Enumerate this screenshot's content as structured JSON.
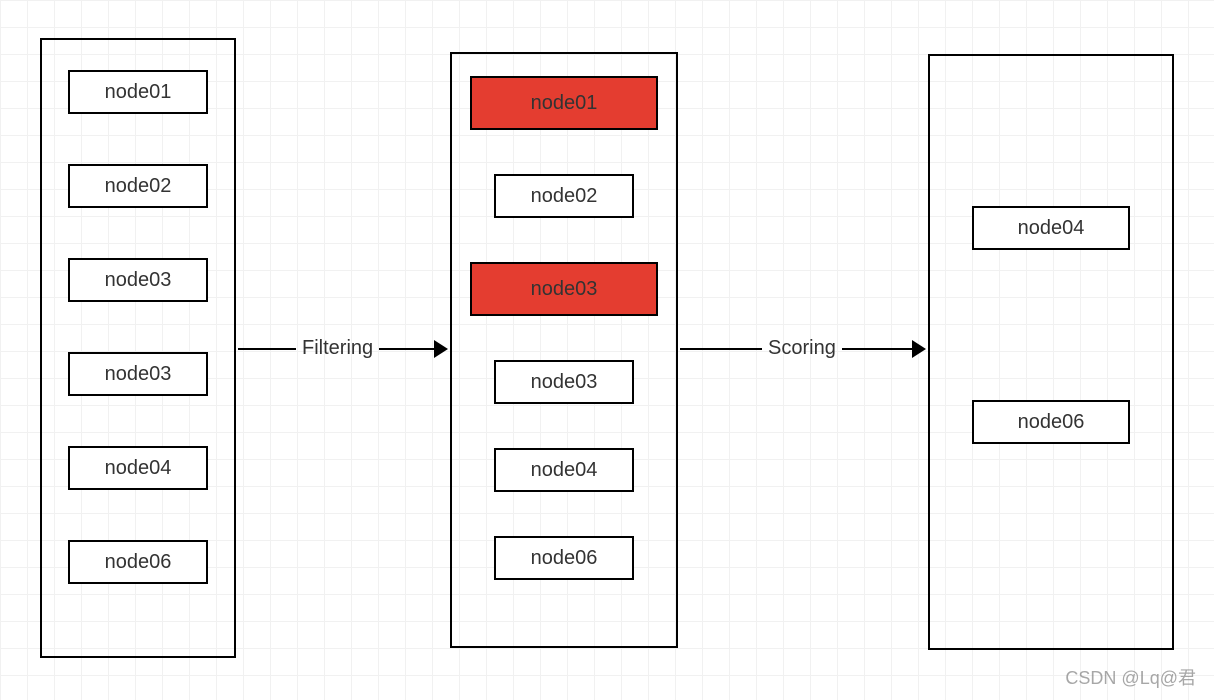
{
  "stages": {
    "left": {
      "nodes": [
        "node01",
        "node02",
        "node03",
        "node03",
        "node04",
        "node06"
      ],
      "highlighted": []
    },
    "middle": {
      "nodes": [
        "node01",
        "node02",
        "node03",
        "node03",
        "node04",
        "node06"
      ],
      "highlighted": [
        0,
        2
      ]
    },
    "right": {
      "nodes": [
        "node04",
        "node06"
      ],
      "highlighted": []
    }
  },
  "arrows": {
    "first": {
      "label": "Filtering"
    },
    "second": {
      "label": "Scoring"
    }
  },
  "watermark": "CSDN @Lq@君"
}
